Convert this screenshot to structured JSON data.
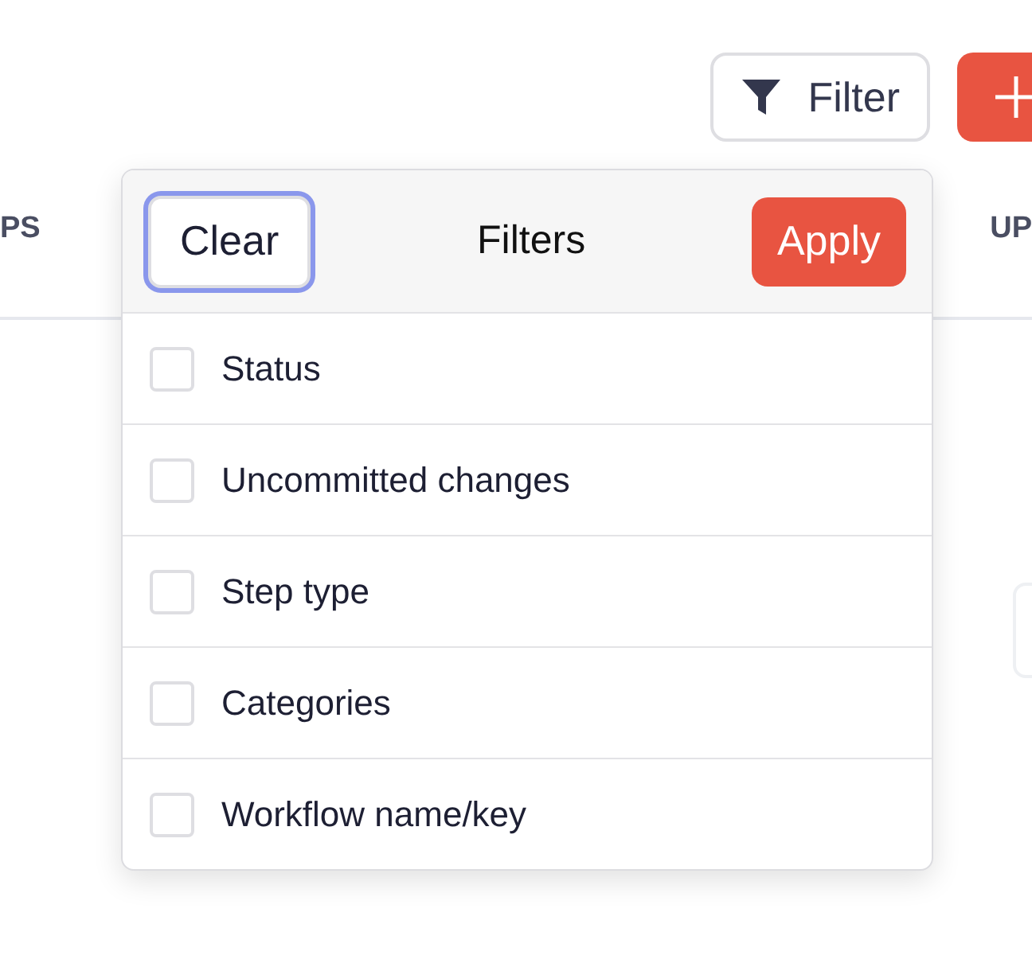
{
  "toolbar": {
    "filter_button": "Filter"
  },
  "table_header": {
    "column_1": "PS",
    "column_2": "UP"
  },
  "filter_panel": {
    "title": "Filters",
    "clear_button": {
      "label": "Clear",
      "focused": true
    },
    "apply_button": "Apply",
    "options": [
      {
        "label": "Status",
        "checked": false
      },
      {
        "label": "Uncommitted changes",
        "checked": false
      },
      {
        "label": "Step type",
        "checked": false
      },
      {
        "label": "Categories",
        "checked": false
      },
      {
        "label": "Workflow name/key",
        "checked": false
      }
    ]
  }
}
